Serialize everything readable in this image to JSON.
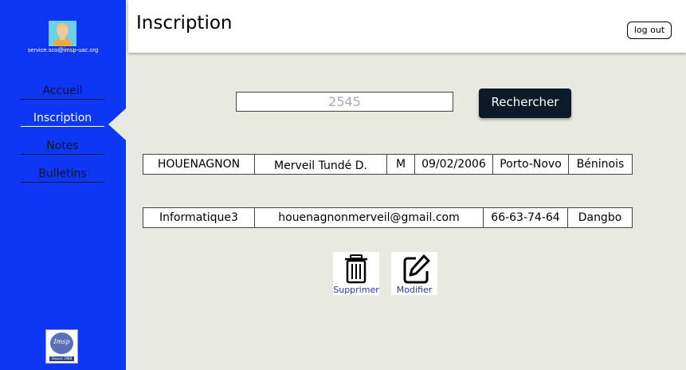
{
  "user": {
    "email": "service.sco@imsp-uac.org",
    "avatar_icon": "user-avatar-icon"
  },
  "sidebar": {
    "items": [
      {
        "label": "Accueil",
        "active": false
      },
      {
        "label": "Inscription",
        "active": true
      },
      {
        "label": "Notes",
        "active": false
      },
      {
        "label": "Bulletins",
        "active": false
      }
    ],
    "logo_text": "Imsp",
    "logo_subtext": "Depuis 1988"
  },
  "header": {
    "title": "Inscription",
    "logout_label": "log out"
  },
  "search": {
    "value": "2545",
    "button_label": "Rechercher"
  },
  "student": {
    "row1": [
      "HOUENAGNON",
      "Merveil Tundé D.",
      "M",
      "09/02/2006",
      "Porto-Novo",
      "Béninois"
    ],
    "row2": [
      "Informatique3",
      "houenagnonmerveil@gmail.com",
      "66-63-74-64",
      "Dangbo"
    ]
  },
  "actions": {
    "delete_label": "Supprimer",
    "edit_label": "Modifier",
    "delete_icon": "trash-icon",
    "edit_icon": "edit-icon"
  },
  "colors": {
    "sidebar": "#0d36f5",
    "background": "#e8eae2",
    "button_dark": "#0c1a2a",
    "action_label": "#2534b8"
  }
}
